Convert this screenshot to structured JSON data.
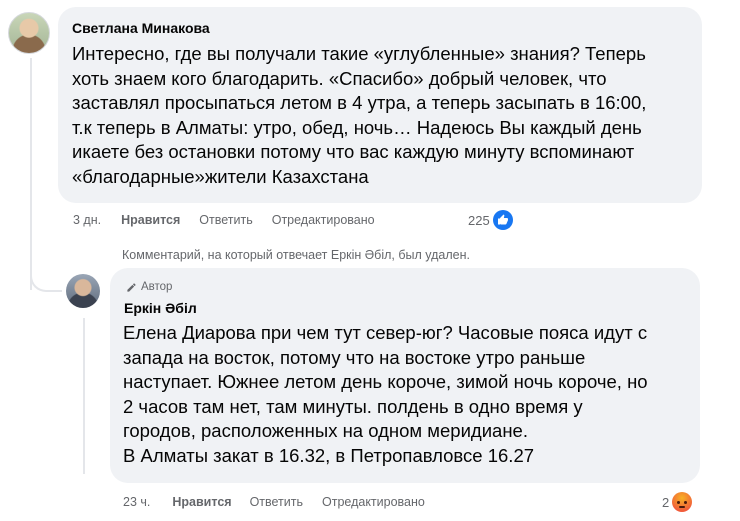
{
  "comment": {
    "author": "Светлана Минакова",
    "lines": [
      "Интересно, где вы получали такие «углубленные» знания? Теперь",
      "хоть знаем кого благодарить. «Спасибо» добрый человек, что",
      "заставлял просыпаться летом в 4 утра, а теперь засыпать в 16:00,",
      "т.к теперь в Алматы: утро, обед, ночь… Надеюсь Вы каждый день",
      "икаете без остановки потому что вас каждую минуту вспоминают",
      "«благодарные»жители Казахстана"
    ],
    "time": "3 дн.",
    "like_label": "Нравится",
    "reply_label": "Ответить",
    "edited_label": "Отредактировано",
    "reaction_count": "225",
    "reaction_icon": "like-icon"
  },
  "deleted_notice": "Комментарий, на который отвечает Еркін Әбіл, был удален.",
  "reply": {
    "badge": "Автор",
    "author": "Еркін Әбіл",
    "lines": [
      "Елена Диарова при чем тут север-юг? Часовые пояса идут с",
      "запада на восток, потому что на востоке утро раньше",
      "наступает. Южнее летом день короче, зимой ночь короче, но",
      "2 часов там нет, там минуты. полдень в одно время у",
      "городов, расположенных на одном меридиане.",
      "В Алматы закат в 16.32, в Петропавловсе 16.27"
    ],
    "time": "23 ч.",
    "like_label": "Нравится",
    "reply_label": "Ответить",
    "edited_label": "Отредактировано",
    "reaction_count": "2",
    "reaction_icon": "angry-icon"
  },
  "colors": {
    "bubble": "#f0f2f5",
    "meta_text": "#65676b",
    "like_blue": "#1877f2"
  }
}
